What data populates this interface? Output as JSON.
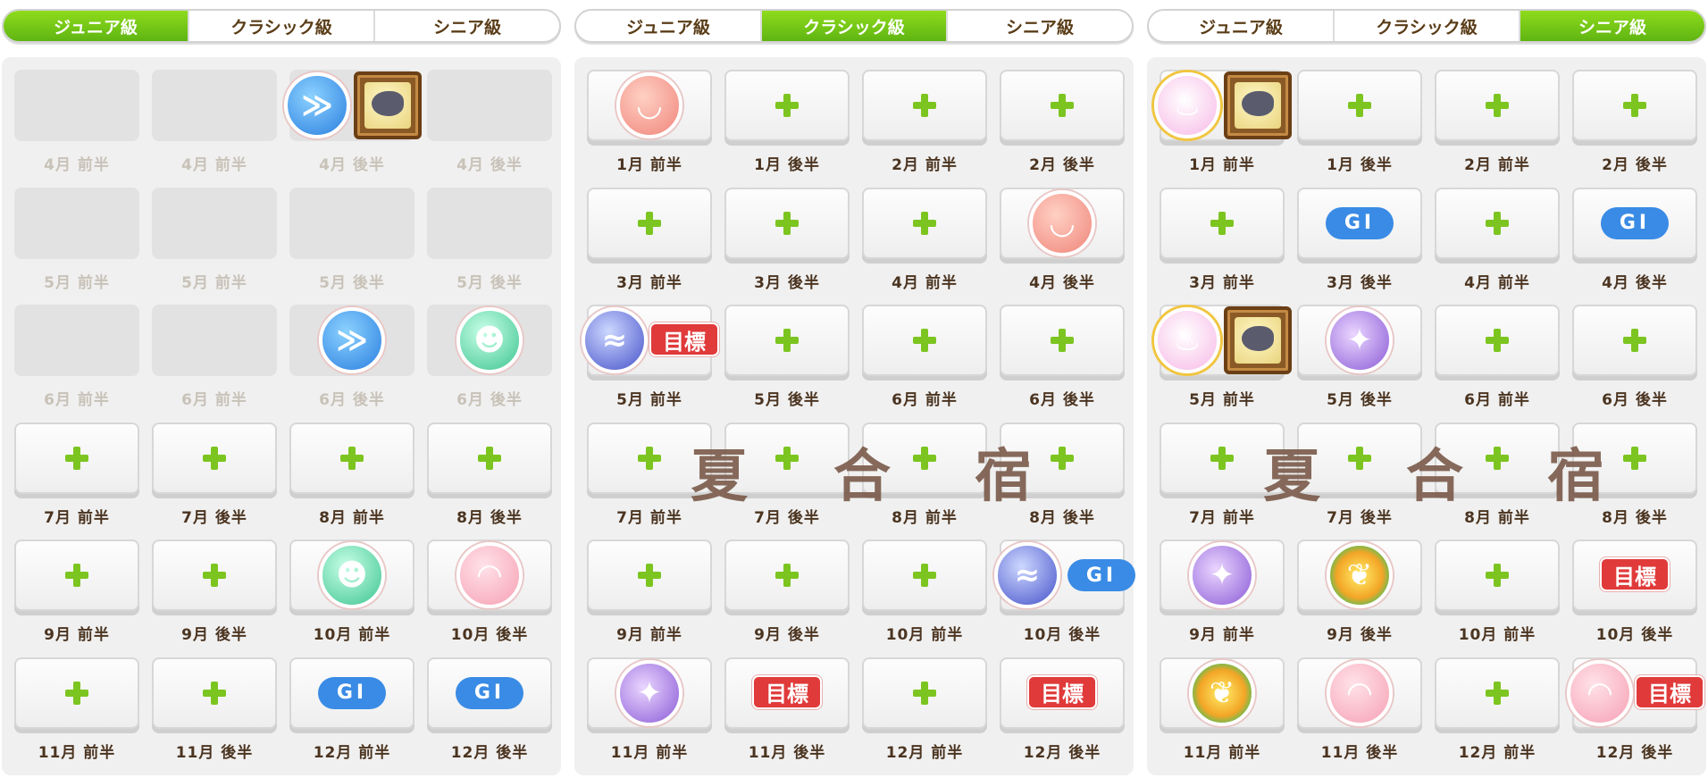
{
  "tabs": [
    "ジュニア級",
    "クラシック級",
    "シニア級"
  ],
  "panels": [
    {
      "active_tab": 0,
      "cells": [
        {
          "label": "4月 前半",
          "dim": true
        },
        {
          "label": "4月 前半",
          "dim": true
        },
        {
          "label": "4月 後半",
          "dim": true,
          "icon": "speed",
          "card": true
        },
        {
          "label": "4月 後半",
          "dim": true
        },
        {
          "label": "5月 前半",
          "dim": true
        },
        {
          "label": "5月 前半",
          "dim": true
        },
        {
          "label": "5月 後半",
          "dim": true
        },
        {
          "label": "5月 後半",
          "dim": true
        },
        {
          "label": "6月 前半",
          "dim": true
        },
        {
          "label": "6月 前半",
          "dim": true
        },
        {
          "label": "6月 後半",
          "dim": true,
          "icon": "speed"
        },
        {
          "label": "6月 後半",
          "dim": true,
          "icon": "guts"
        },
        {
          "label": "7月 前半",
          "plus": true
        },
        {
          "label": "7月 後半",
          "plus": true
        },
        {
          "label": "8月 前半",
          "plus": true
        },
        {
          "label": "8月 後半",
          "plus": true
        },
        {
          "label": "9月 前半",
          "plus": true
        },
        {
          "label": "9月 後半",
          "plus": true
        },
        {
          "label": "10月 前半",
          "icon": "guts"
        },
        {
          "label": "10月 後半",
          "icon": "wise"
        },
        {
          "label": "11月 前半",
          "plus": true
        },
        {
          "label": "11月 後半",
          "plus": true
        },
        {
          "label": "12月 前半",
          "badge": "GI"
        },
        {
          "label": "12月 後半",
          "badge": "GI"
        }
      ]
    },
    {
      "active_tab": 1,
      "camp_text": [
        "夏",
        "合",
        "宿"
      ],
      "cells": [
        {
          "label": "1月 前半",
          "icon": "power"
        },
        {
          "label": "1月 後半",
          "plus": true
        },
        {
          "label": "2月 前半",
          "plus": true
        },
        {
          "label": "2月 後半",
          "plus": true
        },
        {
          "label": "3月 前半",
          "plus": true
        },
        {
          "label": "3月 後半",
          "plus": true
        },
        {
          "label": "4月 前半",
          "plus": true
        },
        {
          "label": "4月 後半",
          "icon": "power"
        },
        {
          "label": "5月 前半",
          "icon": "wind",
          "goal": "目標"
        },
        {
          "label": "5月 後半",
          "plus": true
        },
        {
          "label": "6月 前半",
          "plus": true
        },
        {
          "label": "6月 後半",
          "plus": true
        },
        {
          "label": "7月 前半",
          "plus": true
        },
        {
          "label": "7月 後半",
          "plus": true
        },
        {
          "label": "8月 前半",
          "plus": true
        },
        {
          "label": "8月 後半",
          "plus": true
        },
        {
          "label": "9月 前半",
          "plus": true
        },
        {
          "label": "9月 後半",
          "plus": true
        },
        {
          "label": "10月 前半",
          "plus": true
        },
        {
          "label": "10月 後半",
          "icon": "wind",
          "badge": "GI"
        },
        {
          "label": "11月 前半",
          "icon": "star"
        },
        {
          "label": "11月 後半",
          "goal": "目標"
        },
        {
          "label": "12月 前半",
          "plus": true
        },
        {
          "label": "12月 後半",
          "goal": "目標"
        }
      ]
    },
    {
      "active_tab": 2,
      "camp_text": [
        "夏",
        "合",
        "宿"
      ],
      "cells": [
        {
          "label": "1月 前半",
          "icon": "onsen",
          "card": true
        },
        {
          "label": "1月 後半",
          "plus": true
        },
        {
          "label": "2月 前半",
          "plus": true
        },
        {
          "label": "2月 後半",
          "plus": true
        },
        {
          "label": "3月 前半",
          "plus": true
        },
        {
          "label": "3月 後半",
          "badge": "GI"
        },
        {
          "label": "4月 前半",
          "plus": true
        },
        {
          "label": "4月 後半",
          "badge": "GI"
        },
        {
          "label": "5月 前半",
          "icon": "onsen",
          "card": true
        },
        {
          "label": "5月 後半",
          "icon": "star"
        },
        {
          "label": "6月 前半",
          "plus": true
        },
        {
          "label": "6月 後半",
          "plus": true
        },
        {
          "label": "7月 前半",
          "plus": true
        },
        {
          "label": "7月 後半",
          "plus": true
        },
        {
          "label": "8月 前半",
          "plus": true
        },
        {
          "label": "8月 後半",
          "plus": true
        },
        {
          "label": "9月 前半",
          "icon": "star"
        },
        {
          "label": "9月 後半",
          "icon": "leaf"
        },
        {
          "label": "10月 前半",
          "plus": true
        },
        {
          "label": "10月 後半",
          "goal": "目標"
        },
        {
          "label": "11月 前半",
          "icon": "leaf"
        },
        {
          "label": "11月 後半",
          "icon": "wise"
        },
        {
          "label": "12月 前半",
          "plus": true
        },
        {
          "label": "12月 後半",
          "icon": "wise",
          "goal": "目標"
        }
      ]
    }
  ]
}
